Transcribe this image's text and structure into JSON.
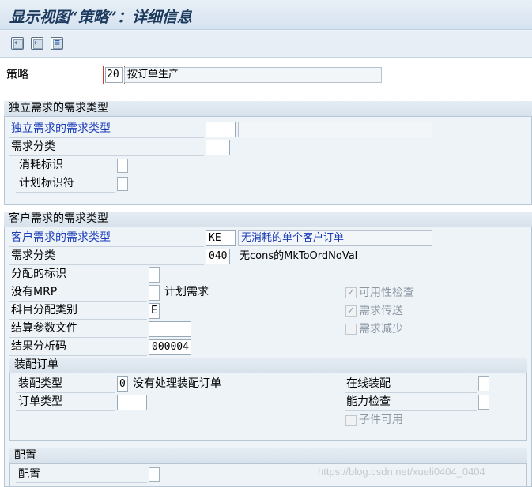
{
  "window": {
    "title": "显示视图“策略”：详细信息"
  },
  "toolbar": {
    "buttons": [
      {
        "icon": "previous-entry-icon"
      },
      {
        "icon": "next-entry-icon"
      },
      {
        "icon": "other-entry-icon"
      }
    ]
  },
  "strategy": {
    "label": "策略",
    "code": "20",
    "description": "按订单生产"
  },
  "independent": {
    "header": "独立需求的需求类型",
    "req_type_label": "独立需求的需求类型",
    "req_type_code": "",
    "req_type_desc": "",
    "req_class_label": "需求分类",
    "req_class_value": "",
    "consumption_label": "消耗标识",
    "planning_label": "计划标识符"
  },
  "customer": {
    "header": "客户需求的需求类型",
    "req_type_label": "客户需求的需求类型",
    "req_type_code": "KE",
    "req_type_desc": "无消耗的单个客户订单",
    "req_class_label": "需求分类",
    "req_class_value": "040",
    "req_class_desc": "无cons的MkToOrdNoVal",
    "alloc_label": "分配的标识",
    "no_mrp_label": "没有MRP",
    "plan_req_label": "计划需求",
    "acct_assign_label": "科目分配类别",
    "acct_assign_value": "E",
    "settle_label": "结算参数文件",
    "settle_value": "",
    "result_label": "结果分析码",
    "result_value": "000004",
    "availability_label": "可用性检查",
    "req_transfer_label": "需求传送",
    "req_reduce_label": "需求减少"
  },
  "assembly": {
    "header": "装配订单",
    "type_label": "装配类型",
    "type_value": "0",
    "type_desc": "没有处理装配订单",
    "order_type_label": "订单类型",
    "online_label": "在线装配",
    "capacity_label": "能力检查",
    "component_label": "子件可用"
  },
  "config": {
    "header": "配置",
    "label": "配置"
  },
  "watermark": "https://blog.csdn.net/xueli0404_0404"
}
